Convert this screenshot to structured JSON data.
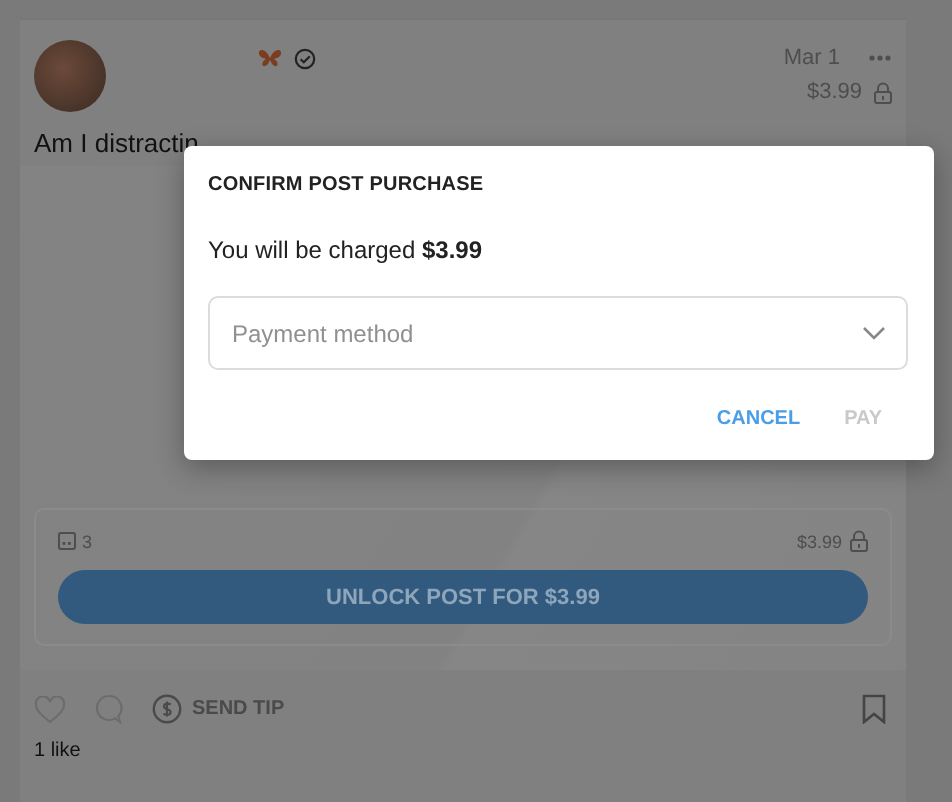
{
  "post": {
    "date": "Mar 1",
    "price": "$3.99",
    "text": "Am I distractin",
    "media": {
      "count": "3",
      "price": "$3.99",
      "unlock_button": "UNLOCK POST FOR $3.99"
    },
    "tip_label": "SEND TIP",
    "likes": "1 like"
  },
  "dialog": {
    "title": "CONFIRM POST PURCHASE",
    "message": "You will be charged **$3.99**",
    "payment_field": {
      "placeholder": "Payment method"
    },
    "buttons": [
      {
        "label": "CANCEL",
        "disabled": false
      },
      {
        "label": "PAY",
        "disabled": true
      }
    ]
  }
}
